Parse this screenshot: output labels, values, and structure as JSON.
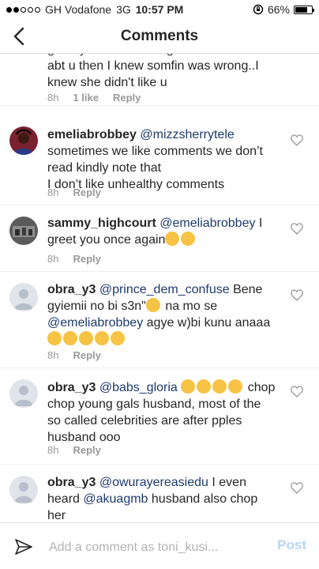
{
  "status_bar": {
    "carrier": "GH Vodafone",
    "network": "3G",
    "time": "10:57 PM",
    "battery": "66%",
    "battery_level": 0.66
  },
  "nav": {
    "title": "Comments"
  },
  "comments": [
    {
      "partial_text": "granny Diamond's negative comments abt u then I knew somfin was wrong..I knew she didn't like u",
      "time": "8h",
      "likes": "1 like",
      "reply": "Reply"
    },
    {
      "user": "emeliabrobbey",
      "mention": "@mizzsherrytele",
      "text": "sometimes we like comments we don’t read kindly note that",
      "text2": "I don’t like unhealthy comments",
      "time": "8h",
      "reply": "Reply"
    },
    {
      "user": "sammy_highcourt",
      "mention": "@emeliabrobbey",
      "text": "I greet you once again",
      "time": "8h",
      "reply": "Reply"
    },
    {
      "user": "obra_y3",
      "mention": "@prince_dem_confuse",
      "text": "Bene gyiemii no  bi s3n\"",
      "text_b": "na mo se",
      "mention2": "@emeliabrobbey",
      "text2": "agye w)bi kunu anaaa",
      "time": "8h",
      "reply": "Reply"
    },
    {
      "user": "obra_y3",
      "mention": "@babs_gloria",
      "text": "chop chop young gals husband, most of the so called celebrities are after pples husband ooo",
      "time": "8h",
      "reply": "Reply"
    },
    {
      "user": "obra_y3",
      "mention": "@owurayereasiedu",
      "text": "I even heard",
      "mention2": "@akuagmb",
      "text2": "husband also chop her"
    }
  ],
  "input": {
    "placeholder": "Add a comment as toni_kusi...",
    "post_label": "Post"
  },
  "colors": {
    "mention": "#1e3a6e",
    "post_disabled": "#b6d6f7",
    "meta": "#999999"
  }
}
